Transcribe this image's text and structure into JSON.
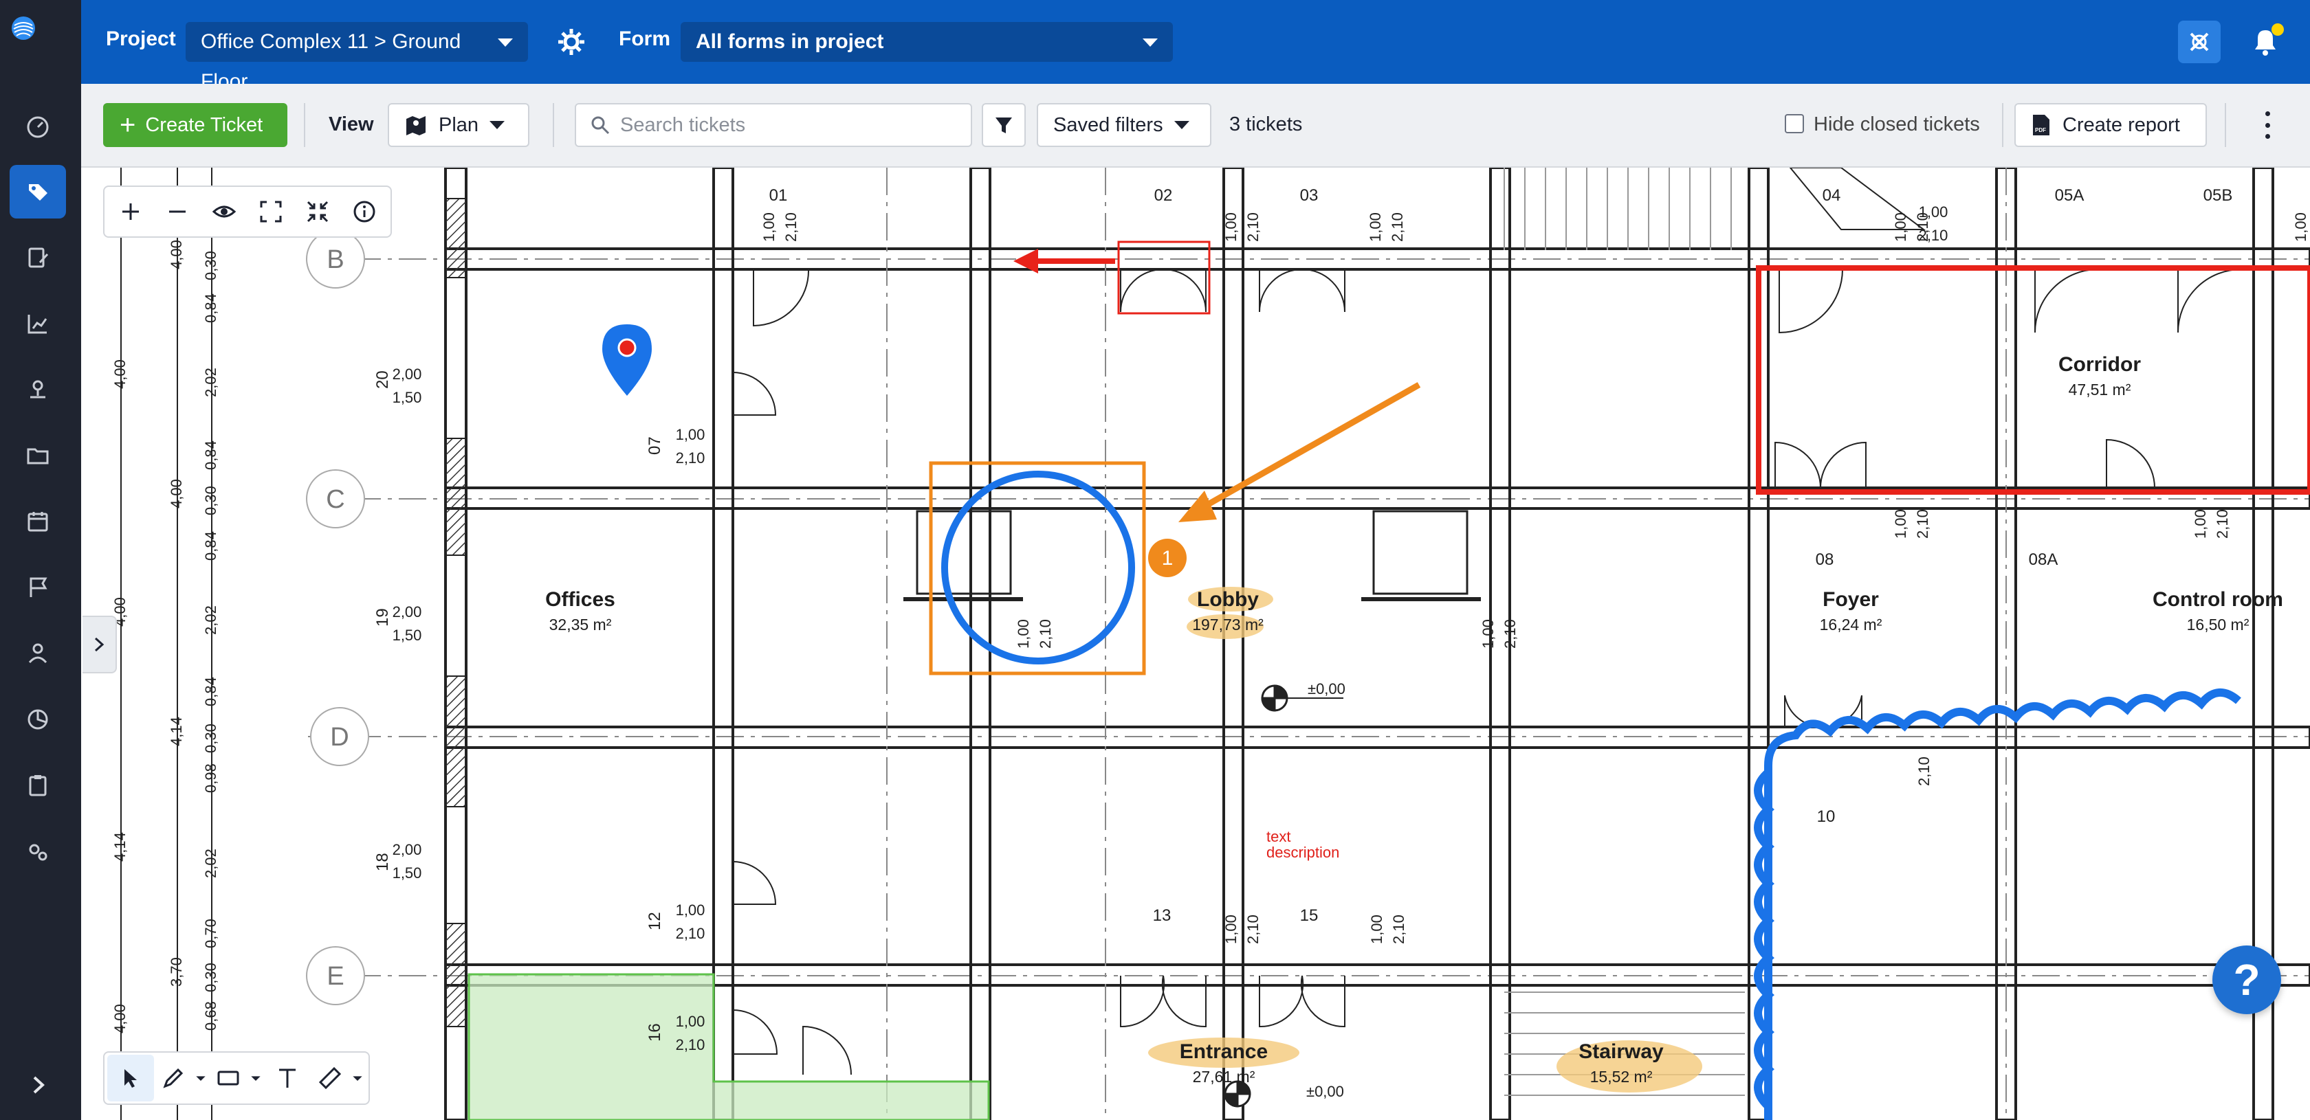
{
  "topbar": {
    "project_label": "Project",
    "project_value": "Office Complex 11 > Ground Floor",
    "form_label": "Form",
    "form_value": "All forms in project"
  },
  "toolbar": {
    "create_ticket": "Create Ticket",
    "view_label": "View",
    "view_value": "Plan",
    "search_placeholder": "Search tickets",
    "saved_filters": "Saved filters",
    "ticket_count": "3 tickets",
    "hide_closed": "Hide closed tickets",
    "create_report": "Create report"
  },
  "sidebar": {
    "items": [
      "dashboard-icon",
      "tickets-icon",
      "forms-icon",
      "reports-icon",
      "inspection-icon",
      "folder-icon",
      "schedule-icon",
      "flag-icon",
      "user-icon",
      "analytics-icon",
      "clipboard-icon",
      "settings-icon"
    ],
    "active": "tickets-icon"
  },
  "plan": {
    "grid_labels": [
      "B",
      "C",
      "D",
      "E"
    ],
    "rooms": [
      {
        "name": "Offices",
        "area": "32,35 m²"
      },
      {
        "name": "Lobby",
        "area": "197,73 m²"
      },
      {
        "name": "Corridor",
        "area": "47,51 m²"
      },
      {
        "name": "Foyer",
        "area": "16,24 m²"
      },
      {
        "name": "Control room",
        "area": "16,50 m²"
      },
      {
        "name": "Entrance",
        "area": "27,61 m²"
      },
      {
        "name": "Stairway",
        "area": "15,52 m²"
      }
    ],
    "door_numbers": [
      "01",
      "02",
      "03",
      "04",
      "05A",
      "05B",
      "07",
      "08",
      "08A",
      "10",
      "12",
      "13",
      "15",
      "16",
      "18",
      "19",
      "20"
    ],
    "door_dims": [
      "1,00",
      "2,10"
    ],
    "level_marks": [
      "±0,00",
      "±0,00"
    ],
    "annotation_text": "text description",
    "marker_number": "1",
    "left_dims": [
      "4,00",
      "0,30",
      "0,84",
      "2,02",
      "4,14",
      "0,98",
      "3,70",
      "0,68",
      "0,70"
    ],
    "row_dims": [
      "2,00",
      "1,50"
    ]
  },
  "colors": {
    "accent": "#0a5cbf",
    "create": "#4aa832",
    "markup_red": "#e8231a",
    "markup_orange": "#f08a1c",
    "markup_blue": "#1a73e8",
    "highlight": "#f4c97a",
    "green_fill": "#c9ebc0"
  },
  "help_label": "?"
}
